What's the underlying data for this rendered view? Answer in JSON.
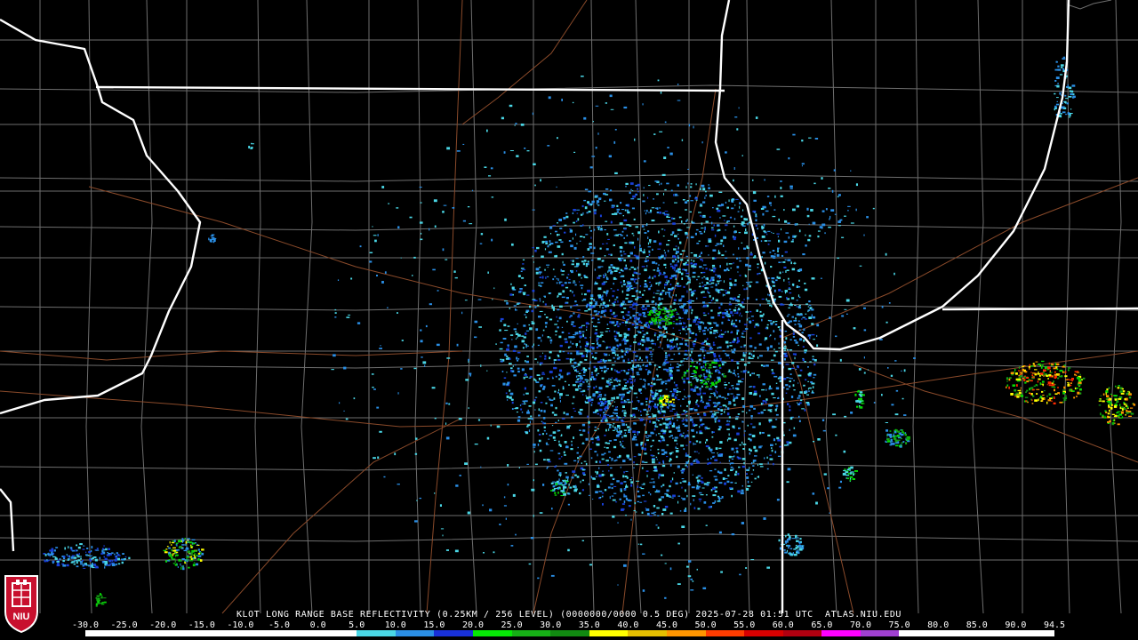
{
  "product_label": "KLOT LONG RANGE BASE REFLECTIVITY (0.25KM / 256 LEVEL) (0000000/0000 0.5 DEG) 2025-07-28 01:51 UTC  ATLAS.NIU.EDU",
  "scale_ticks": [
    "-30.0",
    "-25.0",
    "-20.0",
    "-15.0",
    "-10.0",
    "-5.0",
    "0.0",
    "5.0",
    "10.0",
    "15.0",
    "20.0",
    "25.0",
    "30.0",
    "35.0",
    "40.0",
    "45.0",
    "50.0",
    "55.0",
    "60.0",
    "65.0",
    "70.0",
    "75.0",
    "80.0",
    "85.0",
    "90.0",
    "94.5"
  ],
  "scale_colors": [
    "#ffffff",
    "#ffffff",
    "#ffffff",
    "#ffffff",
    "#ffffff",
    "#ffffff",
    "#ffffff",
    "#4ad7e6",
    "#2a8fe6",
    "#1830d8",
    "#06e806",
    "#16b016",
    "#118a11",
    "#ffff00",
    "#e6c000",
    "#ff9600",
    "#ff3c00",
    "#d70000",
    "#b00010",
    "#ff00ff",
    "#a040d0",
    "#ffffff",
    "#ffffff",
    "#ffffff",
    "#ffffff"
  ],
  "logo_text": "NIU",
  "colors": {
    "background": "#000000",
    "state_border": "#ffffff",
    "county_line": "#707070",
    "road": "#8a4a2a"
  }
}
